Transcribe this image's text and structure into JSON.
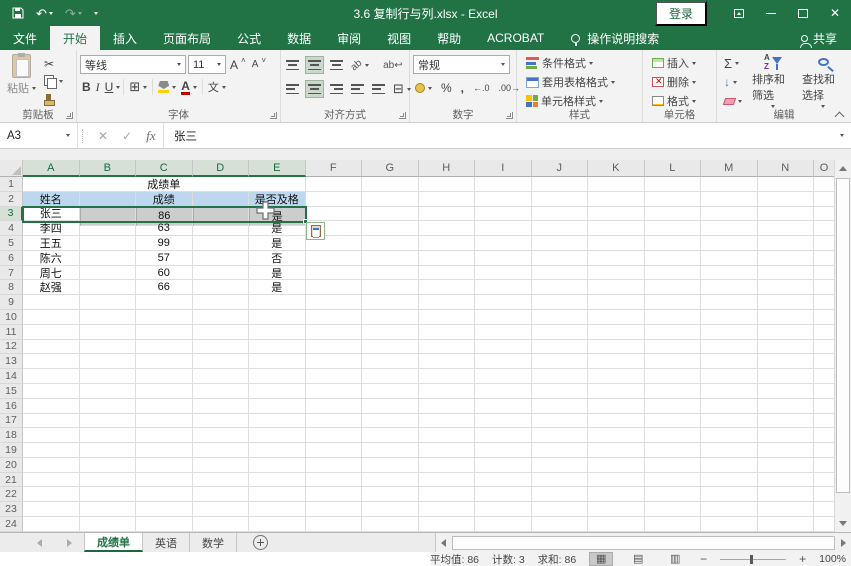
{
  "window": {
    "title": "3.6 复制行与列.xlsx  -  Excel",
    "login_label": "登录"
  },
  "tabs": {
    "file": "文件",
    "items": [
      "开始",
      "插入",
      "页面布局",
      "公式",
      "数据",
      "审阅",
      "视图",
      "帮助",
      "ACROBAT"
    ],
    "active": "开始",
    "search_label": "操作说明搜索",
    "share_label": "共享"
  },
  "ribbon": {
    "clipboard": {
      "paste": "粘贴",
      "group": "剪贴板"
    },
    "font": {
      "name": "等线",
      "size": "11",
      "bold": "B",
      "italic": "I",
      "underline": "U",
      "grow": "A",
      "shrink": "A",
      "color_letter": "A",
      "phonetic": "文",
      "group": "字体"
    },
    "alignment": {
      "orientation": "ab",
      "wrap": "ab↩",
      "group": "对齐方式"
    },
    "number": {
      "format": "常规",
      "percent": "%",
      "comma": ",",
      "inc_decimal": "←.0",
      "dec_decimal": ".00→",
      "group": "数字"
    },
    "styles": {
      "conditional": "条件格式",
      "format_table": "套用表格格式",
      "cell_styles": "单元格样式",
      "group": "样式"
    },
    "cells": {
      "insert": "插入",
      "delete": "删除",
      "format": "格式",
      "group": "单元格"
    },
    "editing": {
      "sum": "Σ",
      "fill": "↓",
      "sort_filter": "排序和筛选",
      "find_select": "查找和选择",
      "group": "编辑"
    }
  },
  "icons": {
    "undo": "↶",
    "redo": "↷",
    "cut": "✂",
    "borders": "⊞",
    "merge": "⊟",
    "check": "✓",
    "cancel": "✕",
    "close": "✕",
    "fx": "fx",
    "view_normal": "▦",
    "view_layout": "▤",
    "view_break": "▥",
    "zoom_out": "−",
    "zoom_in": "+"
  },
  "formula_bar": {
    "name_box": "A3",
    "value": "张三"
  },
  "grid": {
    "col_letters": [
      "A",
      "B",
      "C",
      "D",
      "E",
      "F",
      "G",
      "H",
      "I",
      "J",
      "K",
      "L",
      "M",
      "N",
      "O"
    ],
    "row_count": 24,
    "selected_cols": 5,
    "selected_row": 3,
    "title": "成绩单",
    "headers": {
      "A": "姓名",
      "C": "成绩",
      "E": "是否及格"
    },
    "records": [
      {
        "A": "张三",
        "C": "86",
        "E": "是"
      },
      {
        "A": "李四",
        "C": "63",
        "E": "是"
      },
      {
        "A": "王五",
        "C": "99",
        "E": "是"
      },
      {
        "A": "陈六",
        "C": "57",
        "E": "否"
      },
      {
        "A": "周七",
        "C": "60",
        "E": "是"
      },
      {
        "A": "赵强",
        "C": "66",
        "E": "是"
      }
    ]
  },
  "sheet_tabs": {
    "items": [
      "成绩单",
      "英语",
      "数学"
    ],
    "active_index": 0
  },
  "status_bar": {
    "average": "平均值: 86",
    "count": "计数: 3",
    "sum": "求和: 86",
    "zoom_level": "100%"
  }
}
